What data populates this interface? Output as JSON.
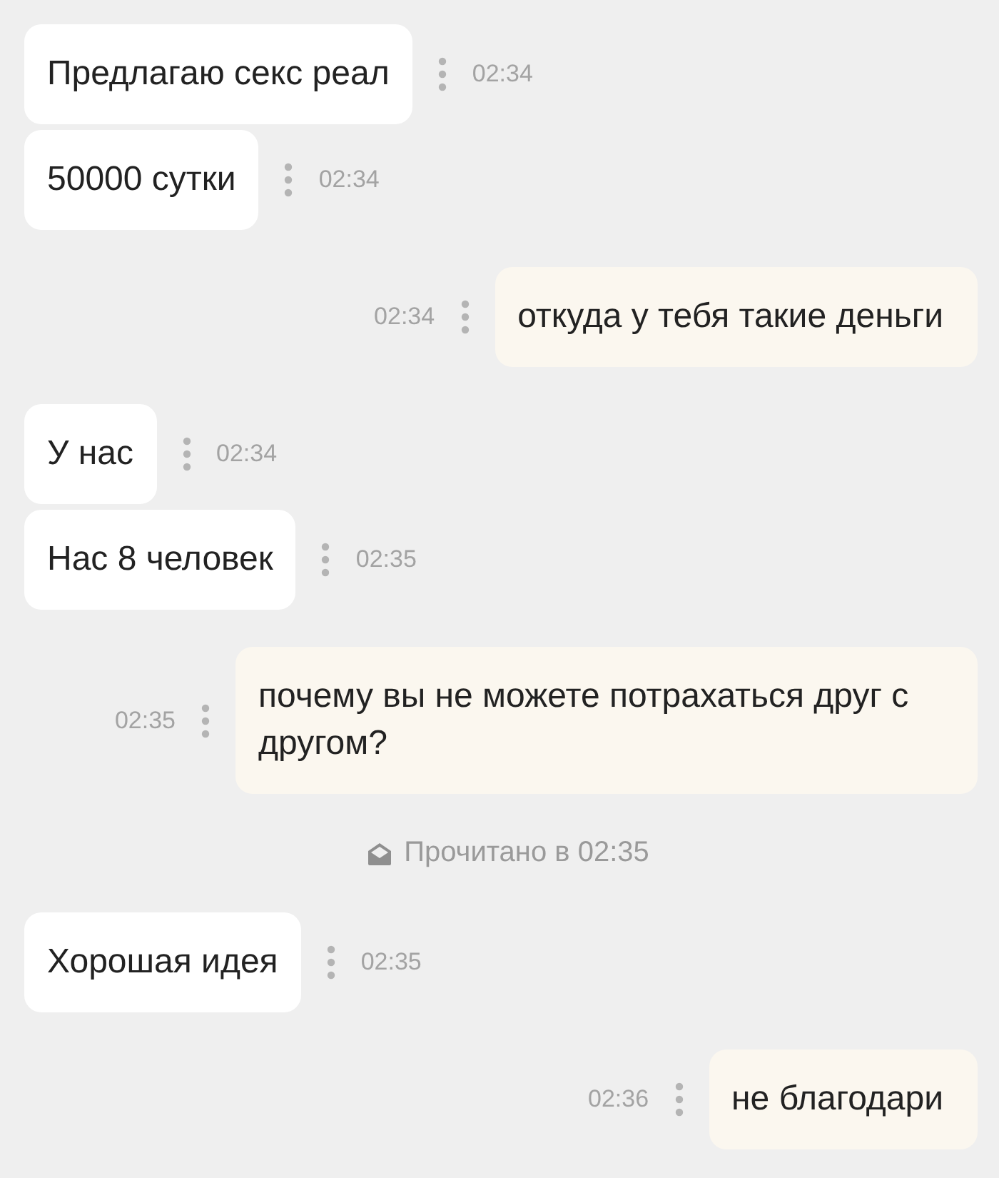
{
  "messages": [
    {
      "kind": "incoming",
      "text": "Предлагаю секс реал",
      "time": "02:34"
    },
    {
      "kind": "incoming",
      "text": "50000 сутки",
      "time": "02:34"
    },
    {
      "kind": "outgoing",
      "text": "откуда у тебя такие деньги",
      "time": "02:34"
    },
    {
      "kind": "incoming",
      "text": "У нас",
      "time": "02:34"
    },
    {
      "kind": "incoming",
      "text": "Нас 8 человек",
      "time": "02:35"
    },
    {
      "kind": "outgoing",
      "text": "почему вы не можете потрахаться друг с другом?",
      "time": "02:35"
    },
    {
      "kind": "status",
      "text": "Прочитано в 02:35"
    },
    {
      "kind": "incoming",
      "text": "Хорошая идея",
      "time": "02:35"
    },
    {
      "kind": "outgoing",
      "text": "не благодари",
      "time": "02:36"
    }
  ]
}
